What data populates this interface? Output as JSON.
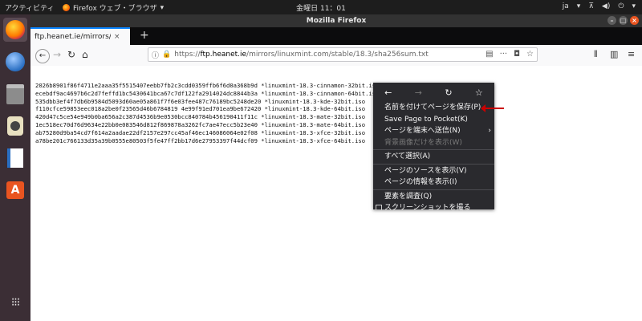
{
  "topbar": {
    "activities": "アクティビティ",
    "app_menu": "Firefox ウェブ・ブラウザ",
    "clock": "金曜日 11：01",
    "lang": "ja"
  },
  "window": {
    "title": "Mozilla Firefox"
  },
  "tab": {
    "title": "ftp.heanet.ie/mirrors/linux",
    "close": "×"
  },
  "navbar": {
    "url_host": "ftp.heanet.ie",
    "url_prefix": "https://",
    "url_path": "/mirrors/linuxmint.com/stable/18.3/sha256sum.txt",
    "more": "···"
  },
  "content": {
    "lines": [
      "2026b8901f86f4711e2aaa35f5515407eebb7fb2c3cdd0359ffb6f6d0a368b9d *linuxmint-18.3-cinnamon-32bit.iso",
      "ecebdf9ac4697b6c2d7feffd1bc5430641bca67c7df122fa2914024dc8844b3a *linuxmint-18.3-cinnamon-64bit.iso",
      "535dbb3ef4f7db6b9584d5093d60ae05a861f7f6e03fee487c76189bc5248de20 *linuxmint-18.3-kde-32bit.iso",
      "f110cfce59853eec018a2be0f23565d46b6784819 4e99f91ed701ea9be672420 *linuxmint-18.3-kde-64bit.iso",
      "420d47c5ce54e949b0ba656a2c387d4536b9e0530bcc840784b456190411f11c *linuxmint-18.3-mate-32bit.iso",
      "1ec518ec70d76d9634e22bb0e083546d812f869878a3262fc7ae47ecc5b23e40 *linuxmint-18.3-mate-64bit.iso",
      "ab75280d9ba54cd7f614a2aadae22df2157e297cc45af46ec146086064e02f08 *linuxmint-18.3-xfce-32bit.iso",
      "a78be201c766133d35a39b0555e80503f5fe47ff2bb17d6e27953397f44dcf09 *linuxmint-18.3-xfce-64bit.iso"
    ]
  },
  "context_menu": {
    "items": [
      {
        "label": "名前を付けてページを保存(P)...",
        "disabled": false
      },
      {
        "label": "Save Page to Pocket(K)",
        "disabled": false
      },
      {
        "label": "ページを端末へ送信(N)",
        "disabled": false
      },
      {
        "label": "背景画像だけを表示(W)",
        "disabled": true
      },
      {
        "label": "すべて選択(A)",
        "disabled": false
      },
      {
        "label": "ページのソースを表示(V)",
        "disabled": false
      },
      {
        "label": "ページの情報を表示(I)",
        "disabled": false
      },
      {
        "label": "要素を調査(Q)",
        "disabled": false
      },
      {
        "label": "スクリーンショットを撮る",
        "disabled": false
      }
    ]
  },
  "colors": {
    "accent": "#0a84ff",
    "annotation_arrow": "#cc0000",
    "dock_bg": "#3b2e35"
  }
}
